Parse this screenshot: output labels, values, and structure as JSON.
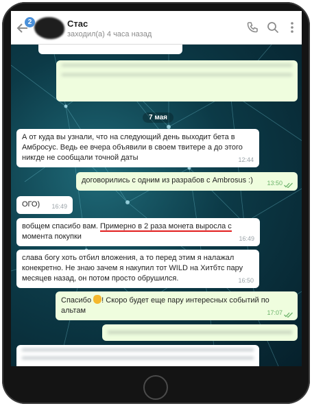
{
  "header": {
    "unread_count": "2",
    "contact_name": "Стас",
    "status": "заходил(а) 4 часа назад"
  },
  "chat": {
    "date_separator": "7 мая",
    "messages": [
      {
        "id": "m1",
        "direction": "in",
        "text": "А от куда вы узнали, что на следующий день выходит бета в Амбросус. Ведь ее вчера объявили в своем твитере а до этого никгде не сообщали точной даты",
        "time": "12:44"
      },
      {
        "id": "m2",
        "direction": "out",
        "text": "договорились с одним из разрабов с Ambrosus :)",
        "time": "13:50",
        "read": true
      },
      {
        "id": "m3",
        "direction": "in",
        "text": "ОГО)",
        "time": "16:49"
      },
      {
        "id": "m4",
        "direction": "in",
        "text_plain_start": "вобщем спасибо вам. ",
        "text_highlight": "Примерно в 2 раза монета выросла с",
        "text_plain_end": " момента покупки",
        "time": "16:49"
      },
      {
        "id": "m5",
        "direction": "in",
        "text": "слава богу хоть отбил вложения, а то перед этим я налажал конекретно. Не знаю зачем я накупил тот WILD на Хитбтс пару месяцев назад, он потом просто обрушился.",
        "time": "16:50"
      },
      {
        "id": "m6",
        "direction": "out",
        "text_before_emoji": "Спасибо ",
        "emoji": "raised-hand",
        "text_after_emoji": "! Скоро будет еще пару интересных событий по альтам",
        "time": "17:07",
        "read": true
      }
    ]
  },
  "colors": {
    "badge": "#4a90d9",
    "outgoing_bubble": "#effdde",
    "incoming_bubble": "#ffffff",
    "read_ticks": "#6cb36a",
    "highlight_underline": "#e21d1d"
  },
  "icons": [
    "back-arrow-icon",
    "phone-icon",
    "search-icon",
    "more-vertical-icon",
    "double-check-icon",
    "raised-hand-emoji"
  ]
}
